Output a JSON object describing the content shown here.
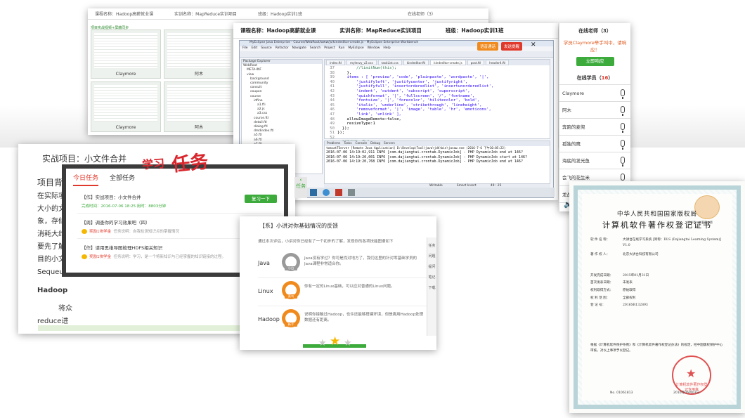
{
  "back_window": {
    "topbar": [
      "课程名称：Hadoop高薪就业课",
      "实训名称：MapReduce实训项目",
      "班级：Hadoop实训1班",
      "在线老师（3）"
    ],
    "green_label": "项目实战视频+屏蔽同步",
    "thumbs": [
      {
        "caption": "Claymore"
      },
      {
        "caption": "阿木"
      },
      {
        "caption": "Claymore"
      },
      {
        "caption": "阿木"
      }
    ]
  },
  "main_window": {
    "course": "课程名称：Hadoop高薪就业课",
    "training": "实训名称：MapReduce实训项目",
    "class": "班级：Hadoop实训1班",
    "btn_voice": "语音通话",
    "btn_remind": "发送提醒",
    "eclipse_title": "MyEclipse Java Enterprise - Course/WebRoot/www/js/kindeditor-create.js - MyEclipse Enterprise Workbench",
    "menu": [
      "File",
      "Edit",
      "Source",
      "Refactor",
      "Navigate",
      "Search",
      "Project",
      "Run",
      "MyEclipse",
      "Window",
      "Help"
    ],
    "explorer_title": "Package Explorer",
    "explorer_items": [
      "WebRoot",
      "META-INF",
      "view",
      "background",
      "community",
      "consult",
      "coupon",
      "course",
      "idfino",
      "a1.fti",
      "a2.js",
      "a3.css",
      "course.ftl",
      "detail.ftl",
      "dialog.ftl",
      "dmdindex.ftl",
      "a5.ftl",
      "a6.ftl",
      "a7.ftl",
      "a8.ftl"
    ],
    "editor_tabs": [
      "index.ftl",
      "mylesvy_v2.css",
      "taskList.css",
      "kindeditor.ftl",
      "kindeditor-create.js",
      "post.ftl",
      "header4.ftl"
    ],
    "line_numbers": [
      "37",
      "38",
      "39",
      "40",
      "41",
      "42",
      "43",
      "44",
      "45",
      "46",
      "47",
      "48",
      "49",
      "50",
      "51",
      "52",
      "53"
    ],
    "code_lines": [
      {
        "t": "        //limitNum(this);",
        "c": "cm"
      },
      {
        "t": "    },",
        "c": "bk"
      },
      {
        "t": "    items : [ 'preview', 'code', 'plainpaste', 'wordpaste', '|',",
        "c": ""
      },
      {
        "t": "        'justifyleft', 'justifycenter', 'justifyright',",
        "c": ""
      },
      {
        "t": "        'justifyfull', 'insertorderedlist', 'insertunorderedlist',",
        "c": ""
      },
      {
        "t": "        'indent', 'outdent', 'subscript', 'superscript',",
        "c": ""
      },
      {
        "t": "        'quickformat', '|', 'fullscreen', '/', 'fontname',",
        "c": ""
      },
      {
        "t": "        'fontsize', '|', 'forecolor', 'hilitecolor', 'bold',",
        "c": ""
      },
      {
        "t": "        'italic', 'underline', 'strikethrough', 'lineheight',",
        "c": ""
      },
      {
        "t": "        'removeformat', '|', 'image', 'table', 'hr', 'emoticons',",
        "c": ""
      },
      {
        "t": "        'link', 'unlink' ],",
        "c": ""
      },
      {
        "t": "    allowImageRemote:false,",
        "c": "bk"
      },
      {
        "t": "    resizeType:1",
        "c": "bk"
      },
      {
        "t": "  });",
        "c": "bk"
      },
      {
        "t": "});",
        "c": "bk"
      },
      {
        "t": "",
        "c": "bk"
      },
      {
        "t": "/*引导提示，完成*/",
        "c": "cm"
      }
    ],
    "console_tabs": [
      "Problems",
      "Tasks",
      "Console",
      "Debug",
      "Servers"
    ],
    "console_lines": [
      "tomcatTServer [Remote Java Application] D:\\Develop\\Tool\\java\\jdk\\bin\\javaw.exe (2016-7-6 下午10:05:22)",
      "2016-07-06 14:19:02,911 INFO [com.dajiangtai.crontab.DynamicJob] - PHP DynamicJob end at 146?",
      "2016-07-06 14:19:20,001 INFO [com.dajiangtai.crontab.DynamicJob] - PHP DynamicJob start at 146?",
      "2016-07-06 14:19:20,768 INFO [com.dajiangtai.crontab.DynamicJob] - PHP DynamicJob end at 146?"
    ],
    "status": [
      "Writable",
      "Smart Insert",
      "49 : 25"
    ]
  },
  "online_panel": {
    "teachers_title": "在线老师（3）",
    "hand_raise": "学员Claymore举手叫中，请响应！",
    "answer_btn": "立即响应",
    "students_title": "在线学员",
    "students_count": "16",
    "students": [
      "Claymore",
      "阿木",
      "奔跑的麦兜",
      "孤独的鹰",
      "海底的发光鱼",
      "会飞的花生米",
      "龙战于野"
    ]
  },
  "task_card": {
    "title": "实战项目：小文件合并",
    "left_lines": [
      "项目背",
      "在实际项",
      "大小的文",
      "象，存储",
      "消耗大约",
      "要先了解",
      "目的小文",
      "Sequeue",
      "Hadoop",
      "将众",
      "reduce进"
    ],
    "popup": {
      "tab_today": "今日任务",
      "tab_all": "全部任务",
      "deco_small": "学习",
      "deco_big": "任务",
      "side_tab": "任务",
      "items": [
        {
          "name": "【作】实战项目：小文件合并",
          "meta": "完成时间：2016-07-06 18:25   用时：8803分钟",
          "reward": "",
          "btn": "复习一下"
        },
        {
          "name": "【周】调查你的学习效果吧（四）",
          "meta": "任务说明：自我检测知识点的掌握情况",
          "reward": "奖励1块学金",
          "btn": ""
        },
        {
          "name": "【作】请用思维导图梳理HDFS相关知识",
          "meta": "任务说明：学习，是一个将新知识与已经掌握的知识链接的过程。",
          "reward": "奖励1块学金",
          "btn": ""
        }
      ]
    }
  },
  "survey_card": {
    "title": "【系】小讲对你基础情况的反馈",
    "desc": "通过本次评估，小讲对你已经有了一个初步的了解，发现你的各项技能图谱如下",
    "rows": [
      {
        "lang": "Java",
        "badge": "小白",
        "color": "#9a9a9a",
        "desc": "Java没有学过？你可是找对地方了，我们这里的针对零基础学员的Java课程非常适合你。"
      },
      {
        "lang": "Linux",
        "badge": "菜鸟",
        "color": "#f08a1d",
        "desc": "你有一定的Linux基础，可以应对普通的Linux问题。"
      },
      {
        "lang": "Hadoop",
        "badge": "新手",
        "color": "#f08a1d",
        "desc": "说明你接触过Hadoop，也许还能够搭建环境，但是离用Hadoop处理数据还有距离。"
      }
    ],
    "side_icons": [
      "任务",
      "问题",
      "提问",
      "笔记",
      "下载"
    ]
  },
  "certificate": {
    "heading1": "中华人民共和国国家版权局",
    "heading2": "计算机软件著作权登记证书",
    "corner_no": "证书号：软著登字第",
    "fields": [
      {
        "k": "软 件 名 称：",
        "v": "大讲台在线学习系统 [简称：DLS (Dajiangtai Learning System)] V1.0"
      },
      {
        "k": "著 作 权 人：",
        "v": "北京大讲台科技有限公司"
      },
      {
        "k": "开发完成日期：",
        "v": "2015年01月31日"
      },
      {
        "k": "首次发表日期：",
        "v": "未发表"
      },
      {
        "k": "权利取得方式：",
        "v": "原始取得"
      },
      {
        "k": "权 利 范 围：",
        "v": "全部权利"
      },
      {
        "k": "登 记 号：",
        "v": "2016SR132893"
      }
    ],
    "paragraph": "根据《计算机软件保护条例》和《计算机软件著作权登记办法》的规定，经中国版权保护中心审核，对以上事项予以登记。",
    "seal_text": "计算机软件著作权登记专用章",
    "number": "No. 01061813",
    "date": "2016年06月03日"
  }
}
